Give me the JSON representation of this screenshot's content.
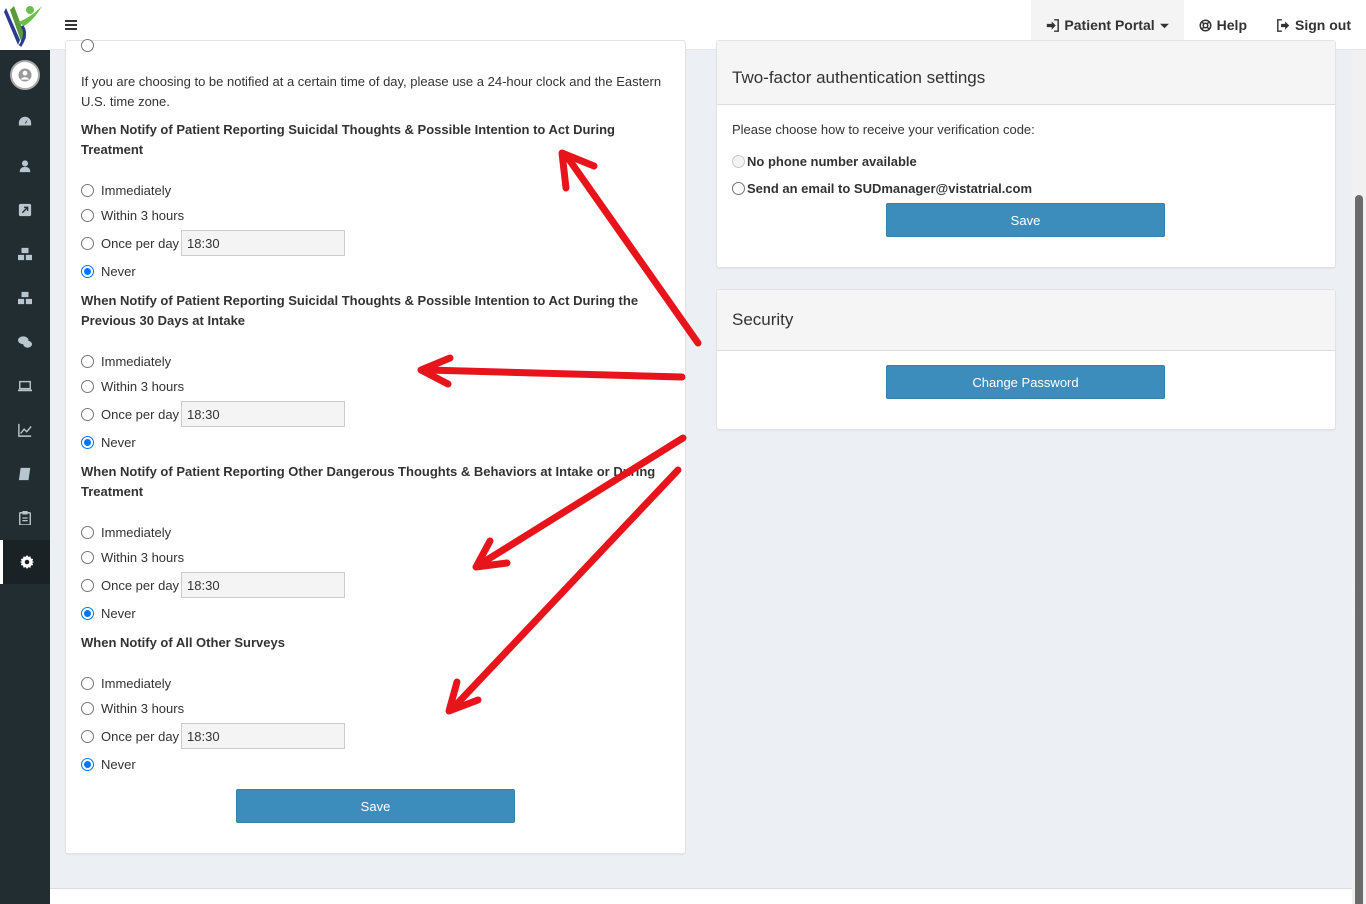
{
  "nav": {
    "portal_label": "Patient Portal",
    "help_label": "Help",
    "signout_label": "Sign out"
  },
  "sidebar": {
    "items": [
      "user-avatar",
      "dashboard-icon",
      "user-icon",
      "external-link-icon",
      "cubes-icon",
      "cubes-icon",
      "wechat-icon",
      "laptop-icon",
      "line-chart-icon",
      "book-icon",
      "clipboard-icon",
      "gear-icon"
    ],
    "active": "gear-icon"
  },
  "notifications": {
    "note": "If you are choosing to be notified at a certain time of day, please use a 24-hour clock and the Eastern U.S. time zone.",
    "options": {
      "immediately": "Immediately",
      "within3": "Within 3 hours",
      "once": "Once per day",
      "never": "Never"
    },
    "questions": [
      {
        "title": "When Notify of Patient Reporting Suicidal Thoughts & Possible Intention to Act During Treatment",
        "time": "18:30",
        "selected": "Never"
      },
      {
        "title": "When Notify of Patient Reporting Suicidal Thoughts & Possible Intention to Act During the Previous 30 Days at Intake",
        "time": "18:30",
        "selected": "Never"
      },
      {
        "title": "When Notify of Patient Reporting Other Dangerous Thoughts & Behaviors at Intake or During Treatment",
        "time": "18:30",
        "selected": "Never"
      },
      {
        "title": "When Notify of All Other Surveys",
        "time": "18:30",
        "selected": "Never"
      }
    ],
    "save_label": "Save"
  },
  "tfa": {
    "title": "Two-factor authentication settings",
    "prompt": "Please choose how to receive your verification code:",
    "option_phone": "No phone number available",
    "option_email": "Send an email to SUDmanager@vistatrial.com",
    "save_label": "Save"
  },
  "security": {
    "title": "Security",
    "change_password_label": "Change Password"
  },
  "colors": {
    "sidebar_bg": "#222d32",
    "primary_button": "#3c8dbc",
    "annotation_arrow": "#e8141b",
    "radio_checked": "#0075ff"
  }
}
